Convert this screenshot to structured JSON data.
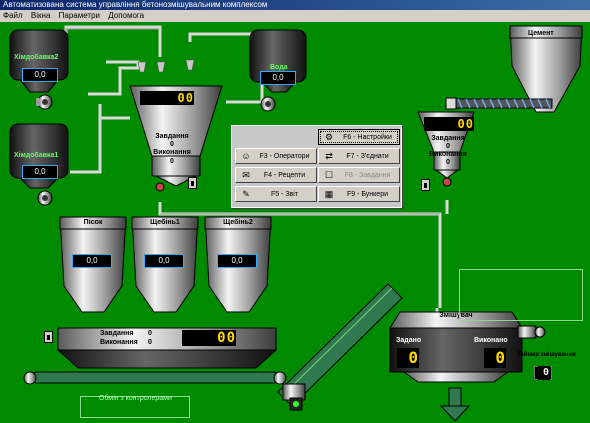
{
  "window": {
    "title": "Автоматизована система управління бетонозмішувальним комплексом"
  },
  "menubar": [
    "Файл",
    "Вікна",
    "Параметри",
    "Допомога"
  ],
  "tanks": {
    "chemical2": {
      "label": "Хімдобавка2",
      "value": "0,0"
    },
    "chemical1": {
      "label": "Хімдобавка1",
      "value": "0,0"
    },
    "water": {
      "label": "Вода",
      "value": "0,0"
    },
    "cement": {
      "label": "Цемент"
    }
  },
  "liquid_hopper": {
    "display": "00",
    "task_label": "Завдання",
    "task_value": "0",
    "done_label": "Виконання",
    "done_value": "0"
  },
  "cement_hopper": {
    "display": "00",
    "task_label": "Завдання",
    "task_value": "0",
    "done_label": "Виконання",
    "done_value": "0"
  },
  "bins": [
    {
      "label": "Пісок",
      "value": "0,0"
    },
    {
      "label": "Щебінь1",
      "value": "0,0"
    },
    {
      "label": "Щебінь2",
      "value": "0,0"
    }
  ],
  "aggregate_scale": {
    "task_label": "Завдання",
    "task_value": "0",
    "done_label": "Виконання",
    "done_value": "0",
    "display": "00"
  },
  "mixer": {
    "label": "Змішувач",
    "set_label": "Задано",
    "set_value": "0",
    "done_label": "Виконано",
    "done_value": "0",
    "timer_label": "Таймер змішування",
    "timer_value": "0"
  },
  "menu_buttons": [
    {
      "key": "f6",
      "label": "F6 - Настройки",
      "icon": "settings-icon",
      "glyph": "⚙"
    },
    {
      "key": "f3",
      "label": "F3 - Оператори",
      "icon": "operators-icon",
      "glyph": "☺"
    },
    {
      "key": "f7",
      "label": "F7 - З'єднати",
      "icon": "connect-icon",
      "glyph": "⇄"
    },
    {
      "key": "f4",
      "label": "F4 - Рецепти",
      "icon": "recipes-icon",
      "glyph": "✉"
    },
    {
      "key": "f8",
      "label": "F8 - Завдання",
      "icon": "tasks-icon",
      "glyph": "☐",
      "disabled": true
    },
    {
      "key": "f5",
      "label": "F5 - Звіт",
      "icon": "report-icon",
      "glyph": "✎"
    },
    {
      "key": "f9",
      "label": "F9 - Бункери",
      "icon": "bins-icon",
      "glyph": "▦"
    }
  ],
  "controllers": {
    "label": "Обмін з контролерами"
  },
  "colors": {
    "background": "#008a00",
    "display_digits": "#ffd800",
    "value_border": "#33aaff"
  }
}
